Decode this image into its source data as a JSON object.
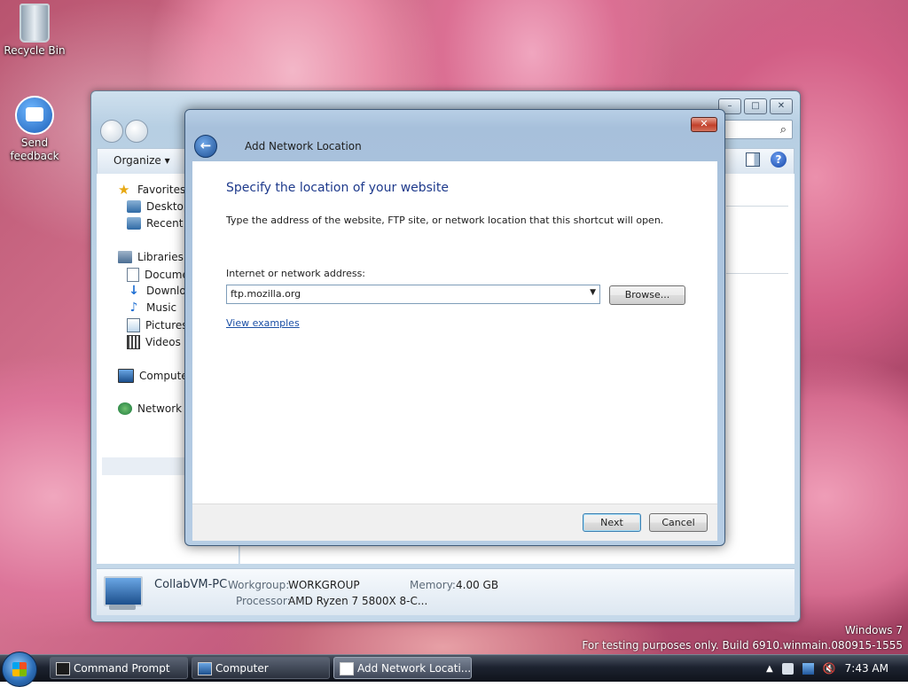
{
  "desktop": {
    "icons": [
      {
        "label": "Recycle Bin"
      },
      {
        "label_line1": "Send",
        "label_line2": "feedback"
      }
    ],
    "watermark": {
      "line1": "Windows 7",
      "line2": "For testing purposes only. Build 6910.winmain.080915-1555"
    }
  },
  "explorer": {
    "caption_buttons": {
      "minimize": "–",
      "maximize": "□",
      "close": "✕"
    },
    "search_tail_icon": "search-icon",
    "toolbar": {
      "organize": "Organize ▾"
    },
    "nav": {
      "favorites": "Favorites",
      "desktop": "Desktop",
      "recent": "Recent P",
      "libraries": "Libraries",
      "documents": "Docume",
      "downloads": "Downloa",
      "music": "Music",
      "pictures": "Pictures",
      "videos": "Videos",
      "computer": "Computer",
      "network": "Network"
    },
    "details": {
      "name": "CollabVM-PC",
      "workgroup_label": "Workgroup:",
      "workgroup_value": "WORKGROUP",
      "memory_label": "Memory:",
      "memory_value": "4.00 GB",
      "processor_label": "Processor:",
      "processor_value": "AMD Ryzen 7 5800X 8-C..."
    }
  },
  "dialog": {
    "title": "Add Network Location",
    "close": "✕",
    "back": "←",
    "heading": "Specify the location of your website",
    "description": "Type the address of the website, FTP site, or network location that this shortcut will open.",
    "address_label": "Internet or network address:",
    "address_value": "ftp.mozilla.org",
    "dropdown_arrow": "▼",
    "browse": "Browse...",
    "view_examples": "View examples",
    "next": "Next",
    "cancel": "Cancel"
  },
  "taskbar": {
    "tasks": [
      {
        "label": "Command Prompt"
      },
      {
        "label": "Computer"
      },
      {
        "label": "Add Network Locati..."
      }
    ],
    "tray_up": "▲",
    "clock": "7:43 AM"
  },
  "colors": {
    "heading": "#1e3a8c",
    "link": "#1a4fa5",
    "taskbar": "#1d2330"
  }
}
